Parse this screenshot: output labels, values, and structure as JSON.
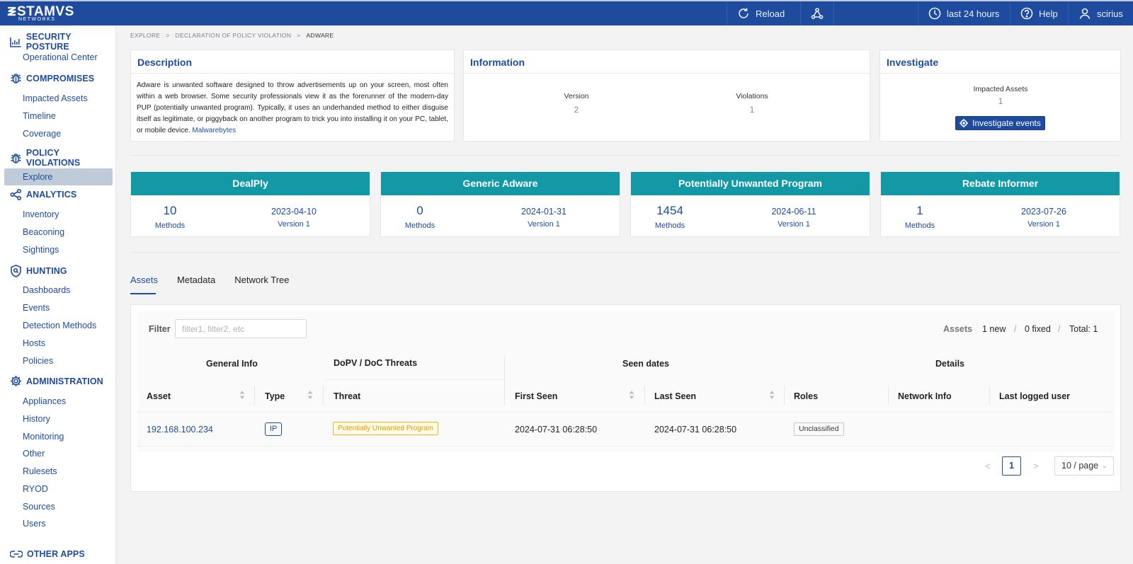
{
  "app": {
    "brand": "STAMVS",
    "brand_sub": "NETWORKS"
  },
  "topbar": {
    "reload": "Reload",
    "timerange": "last 24 hours",
    "help": "Help",
    "user": "scirius"
  },
  "sidebar": {
    "sections": [
      {
        "title": "SECURITY POSTURE",
        "items": [
          "Operational Center"
        ]
      },
      {
        "title": "COMPROMISES",
        "items": [
          "Impacted Assets",
          "Timeline",
          "Coverage"
        ]
      },
      {
        "title": "POLICY VIOLATIONS",
        "items": [
          "Explore"
        ]
      },
      {
        "title": "ANALYTICS",
        "items": [
          "Inventory",
          "Beaconing",
          "Sightings"
        ]
      },
      {
        "title": "HUNTING",
        "items": [
          "Dashboards",
          "Events",
          "Detection Methods",
          "Hosts",
          "Policies"
        ]
      },
      {
        "title": "ADMINISTRATION",
        "items": [
          "Appliances",
          "History",
          "Monitoring",
          "Other",
          "Rulesets",
          "RYOD",
          "Sources",
          "Users"
        ]
      },
      {
        "title": "OTHER APPS",
        "items": []
      }
    ],
    "active": "Explore"
  },
  "breadcrumb": [
    "EXPLORE",
    ">",
    "DECLARATION OF POLICY VIOLATION",
    ">",
    "ADWARE"
  ],
  "description": {
    "title": "Description",
    "text": "Adware is unwanted software designed to throw advertisements up on your screen, most often within a web browser. Some security professionals view it as the forerunner of the modern-day PUP (potentially unwanted program). Typically, it uses an underhanded method to either disguise itself as legitimate, or piggyback on another program to trick you into installing it on your PC, tablet, or mobile device.",
    "link": "Malwarebytes"
  },
  "information": {
    "title": "Information",
    "version_label": "Version",
    "version_value": "2",
    "violations_label": "Violations",
    "violations_value": "1"
  },
  "investigate": {
    "title": "Investigate",
    "impacted_label": "Impacted Assets",
    "impacted_value": "1",
    "button": "Investigate events"
  },
  "cards": [
    {
      "title": "DealPly",
      "methods": "10",
      "methods_label": "Methods",
      "date": "2023-04-10",
      "version": "Version 1"
    },
    {
      "title": "Generic Adware",
      "methods": "0",
      "methods_label": "Methods",
      "date": "2024-01-31",
      "version": "Version 1"
    },
    {
      "title": "Potentially Unwanted Program",
      "methods": "1454",
      "methods_label": "Methods",
      "date": "2024-06-11",
      "version": "Version 1"
    },
    {
      "title": "Rebate Informer",
      "methods": "1",
      "methods_label": "Methods",
      "date": "2023-07-26",
      "version": "Version 1"
    }
  ],
  "tabs": [
    "Assets",
    "Metadata",
    "Network Tree"
  ],
  "filter": {
    "label": "Filter",
    "placeholder": "filter1, filter2, etc"
  },
  "stats": {
    "label": "Assets",
    "new": "1 new",
    "sep": "/",
    "fixed": "0 fixed",
    "total": "Total: 1"
  },
  "table": {
    "groups": [
      "General Info",
      "DoPV / DoC Threats",
      "Seen dates",
      "Details"
    ],
    "columns": [
      "Asset",
      "Type",
      "Threat",
      "First Seen",
      "Last Seen",
      "Roles",
      "Network Info",
      "Last logged user"
    ],
    "rows": [
      {
        "asset": "192.168.100.234",
        "type": "IP",
        "threat": "Potentially Unwanted Program",
        "first_seen": "2024-07-31 06:28:50",
        "last_seen": "2024-07-31 06:28:50",
        "roles": "Unclassified",
        "network_info": "",
        "last_user": ""
      }
    ]
  },
  "pagination": {
    "prev": "<",
    "page": "1",
    "next": ">",
    "page_size": "10 / page"
  }
}
